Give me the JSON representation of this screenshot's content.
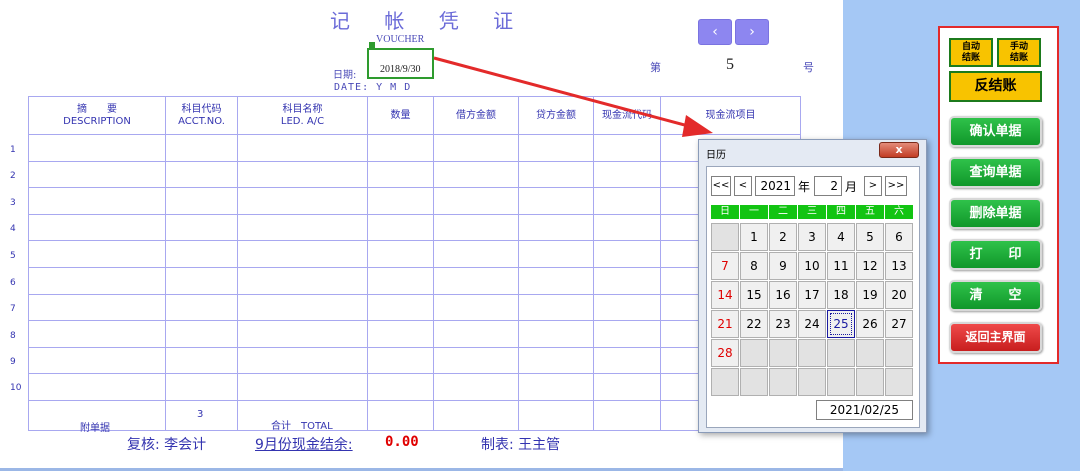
{
  "voucher": {
    "title": "记 帐 凭 证",
    "subtitle": "VOUCHER",
    "date_label": "日期:",
    "date_value": "2018/9/30",
    "date_ymd": "DATE: Y  M  D",
    "prev_label": "‹",
    "next_label": "›",
    "no_label": "第",
    "no_value": "5",
    "no_suffix": "号"
  },
  "table": {
    "headers": [
      {
        "cn": "摘　　要",
        "en": "DESCRIPTION"
      },
      {
        "cn": "科目代码",
        "en": "ACCT.NO."
      },
      {
        "cn": "科目名称",
        "en": "LED. A/C"
      },
      {
        "cn": "数量",
        "en": ""
      },
      {
        "cn": "借方金额",
        "en": ""
      },
      {
        "cn": "贷方金额",
        "en": ""
      },
      {
        "cn": "现金流代码",
        "en": ""
      },
      {
        "cn": "现金流项目",
        "en": ""
      }
    ],
    "row_numbers": [
      "1",
      "2",
      "3",
      "4",
      "5",
      "6",
      "7",
      "8",
      "9",
      "10"
    ],
    "footer": {
      "attach_label": "附单据",
      "attach_count": "3",
      "total_label": "合计　TOTAL"
    }
  },
  "status": {
    "reviewer": "复核: 李会计",
    "cash_label": "9月份现金结余:",
    "cash_value": "0.00",
    "maker": "制表: 王主管"
  },
  "controls": {
    "auto_close": "自动\n结账",
    "manual_close": "手动\n结账",
    "reverse_close": "反结账",
    "confirm": "确认单据",
    "query": "查询单据",
    "delete": "删除单据",
    "print": "打　　印",
    "clear": "清　　空",
    "back": "返回主界面"
  },
  "calendar": {
    "title": "日历",
    "close_label": "x",
    "nav_first": "<<",
    "nav_prev": "<",
    "year_value": "2021",
    "year_label": "年",
    "month_value": "2",
    "month_label": "月",
    "nav_next": ">",
    "nav_last": ">>",
    "weekdays": [
      "日",
      "一",
      "二",
      "三",
      "四",
      "五",
      "六"
    ],
    "days": [
      "",
      "1",
      "2",
      "3",
      "4",
      "5",
      "6",
      "7",
      "8",
      "9",
      "10",
      "11",
      "12",
      "13",
      "14",
      "15",
      "16",
      "17",
      "18",
      "19",
      "20",
      "21",
      "22",
      "23",
      "24",
      "25",
      "26",
      "27",
      "28",
      "",
      "",
      "",
      "",
      "",
      "",
      "",
      "",
      "",
      "",
      "",
      "",
      ""
    ],
    "selected_day": "25",
    "result": "2021/02/25"
  },
  "colors": {
    "accent_blue": "#3434b0",
    "arrow_red": "#e32a2a",
    "button_green": "#10972a",
    "button_yellow": "#f8c300"
  }
}
